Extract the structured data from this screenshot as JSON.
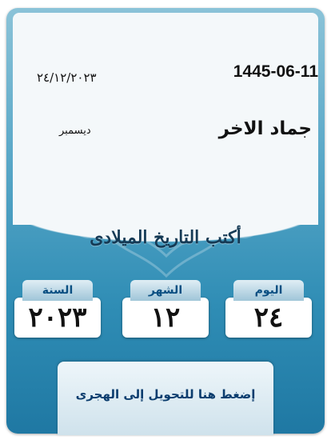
{
  "result": {
    "hijri_date": "1445-06-11",
    "gregorian_date": "٢٤/١٢/٢٠٢٣",
    "hijri_month_name": "جماد الاخر",
    "gregorian_month_name": "ديسمبر"
  },
  "input": {
    "instruction": "أكتب التاريخ الميلادى",
    "year": {
      "label": "السنة",
      "value": "٢٠٢٣"
    },
    "month": {
      "label": "الشهر",
      "value": "١٢"
    },
    "day": {
      "label": "اليوم",
      "value": "٢٤"
    }
  },
  "convert_button": {
    "label": "إضغط هنا للتحويل إلى الهجرى"
  },
  "colors": {
    "card_top": "#8bc3d8",
    "card_bottom": "#1f78a3",
    "label_text": "#0a4f82",
    "instruction_text": "#153a55"
  },
  "icons": [
    "arabesque-ornament-icon"
  ]
}
